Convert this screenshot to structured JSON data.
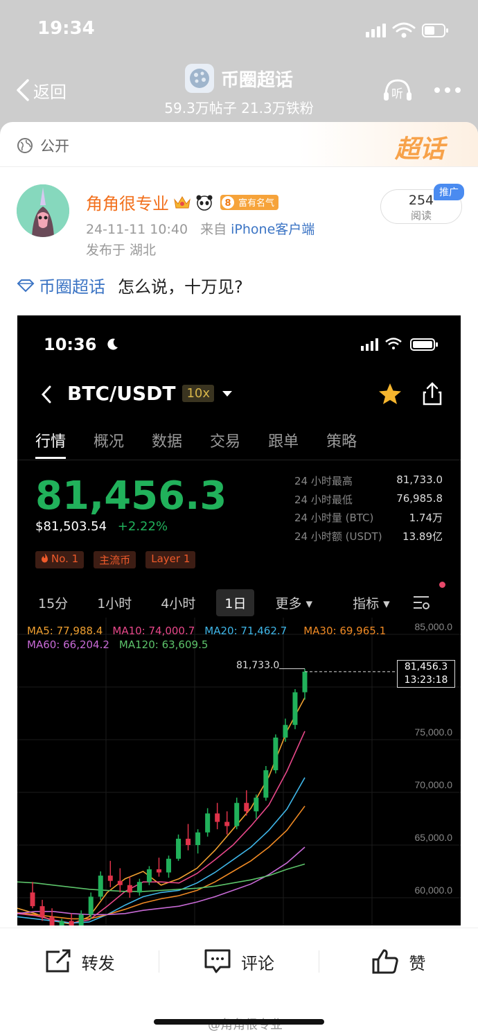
{
  "status_bar": {
    "time": "19:34"
  },
  "nav": {
    "back_label": "返回",
    "topic_name": "币圈超话",
    "topic_stats": "59.3万帖子 21.3万铁粉",
    "listen_label": "听"
  },
  "visibility": {
    "label": "公开",
    "badge": "超话"
  },
  "post": {
    "author": "角角很专业",
    "level_badge": "8",
    "level_text": "富有名气",
    "time": "24-11-11 10:40",
    "from_prefix": "来自",
    "source": "iPhone客户端",
    "location": "发布于 湖北",
    "reads": "254",
    "reads_label": "阅读",
    "promo_label": "推广",
    "topic_tag": "币圈超话",
    "text": "怎么说，十万见?"
  },
  "screenshot": {
    "status_time": "10:36",
    "pair": "BTC/USDT",
    "leverage": "10x",
    "tabs": [
      "行情",
      "概况",
      "数据",
      "交易",
      "跟单",
      "策略"
    ],
    "last_price": "81,456.3",
    "usd_price": "$81,503.54",
    "change_pct": "+2.22%",
    "stats": [
      {
        "label": "24 小时最高",
        "value": "81,733.0"
      },
      {
        "label": "24 小时最低",
        "value": "76,985.8"
      },
      {
        "label": "24 小时量 (BTC)",
        "value": "1.74万"
      },
      {
        "label": "24 小时额 (USDT)",
        "value": "13.89亿"
      }
    ],
    "chips": [
      "No. 1",
      "主流币",
      "Layer 1"
    ],
    "intervals": [
      "15分",
      "1小时",
      "4小时",
      "1日",
      "更多",
      "指标"
    ],
    "ma_row1": [
      {
        "label": "MA5: 77,988.4",
        "color": "#f0a030"
      },
      {
        "label": "MA10: 74,000.7",
        "color": "#e8488a"
      },
      {
        "label": "MA20: 71,462.7",
        "color": "#3fb6e8"
      },
      {
        "label": "MA30: 69,965.1",
        "color": "#f08a24"
      }
    ],
    "ma_row2": [
      {
        "label": "MA60: 66,204.2",
        "color": "#c86ad6"
      },
      {
        "label": "MA120: 63,609.5",
        "color": "#5cc36a"
      }
    ],
    "high_label": "81,733.0",
    "price_tag": "81,456.3",
    "price_tag_time": "13:23:18"
  },
  "chart_data": {
    "type": "line",
    "title": "",
    "y_ticks": [
      "85,000.0",
      "75,000.0",
      "70,000.0",
      "65,000.0",
      "60,000.0"
    ],
    "ylim": [
      58000,
      85000
    ],
    "series": [
      {
        "name": "MA5",
        "color": "#f0a030",
        "values": [
          59000,
          58500,
          57800,
          57500,
          58200,
          60500,
          61800,
          62500,
          61200,
          61800,
          62800,
          64500,
          66500,
          68500,
          71500,
          75800,
          79000
        ]
      },
      {
        "name": "MA10",
        "color": "#e8488a",
        "values": [
          58500,
          58300,
          57900,
          57600,
          57900,
          59200,
          60600,
          61500,
          61500,
          61400,
          62300,
          63600,
          65000,
          66800,
          68800,
          72000,
          75800
        ]
      },
      {
        "name": "MA20",
        "color": "#3fb6e8",
        "values": [
          58200,
          58000,
          57800,
          57600,
          57700,
          58400,
          59300,
          60100,
          60500,
          60700,
          61400,
          62400,
          63600,
          64800,
          66400,
          68400,
          71400
        ]
      },
      {
        "name": "MA30",
        "color": "#f08a24",
        "values": [
          58600,
          58400,
          58200,
          58000,
          58000,
          58400,
          58900,
          59500,
          59900,
          60200,
          60700,
          61500,
          62500,
          63500,
          64800,
          66400,
          68700
        ]
      },
      {
        "name": "MA60",
        "color": "#c86ad6",
        "values": [
          58500,
          58700,
          58700,
          58500,
          58400,
          58400,
          58500,
          58800,
          59000,
          59200,
          59600,
          60100,
          60700,
          61300,
          62200,
          63300,
          64800
        ]
      },
      {
        "name": "MA120",
        "color": "#5cc36a",
        "values": [
          61500,
          61400,
          61200,
          61000,
          60800,
          60700,
          60600,
          60600,
          60700,
          60800,
          60900,
          61100,
          61400,
          61700,
          62100,
          62700,
          63200
        ]
      }
    ],
    "candles": [
      [
        60500,
        61500,
        59000,
        59200
      ],
      [
        59200,
        59800,
        57800,
        58200
      ],
      [
        58200,
        59000,
        56800,
        57200
      ],
      [
        57200,
        58000,
        56500,
        57800
      ],
      [
        57800,
        58500,
        56600,
        57000
      ],
      [
        57000,
        58800,
        56800,
        58400
      ],
      [
        58400,
        60500,
        58000,
        60100
      ],
      [
        60100,
        62500,
        59800,
        62100
      ],
      [
        62100,
        63500,
        61000,
        61600
      ],
      [
        61600,
        62800,
        60500,
        61200
      ],
      [
        61200,
        62000,
        60000,
        60500
      ],
      [
        60500,
        61800,
        60200,
        61500
      ],
      [
        61500,
        63000,
        61200,
        62700
      ],
      [
        62700,
        63800,
        62000,
        62400
      ],
      [
        62400,
        64000,
        61900,
        63700
      ],
      [
        63700,
        66000,
        63500,
        65600
      ],
      [
        65600,
        67000,
        64500,
        65000
      ],
      [
        65000,
        66500,
        64200,
        66200
      ],
      [
        66200,
        68500,
        65800,
        68000
      ],
      [
        68000,
        69000,
        66500,
        67200
      ],
      [
        67200,
        68200,
        66000,
        66800
      ],
      [
        66800,
        69500,
        66500,
        69000
      ],
      [
        69000,
        70200,
        67800,
        68200
      ],
      [
        68200,
        69800,
        67500,
        69500
      ],
      [
        69500,
        72500,
        69200,
        72100
      ],
      [
        72100,
        75500,
        71800,
        75200
      ],
      [
        75200,
        77000,
        74800,
        76400
      ],
      [
        76400,
        79800,
        76000,
        79500
      ],
      [
        79500,
        81733,
        78800,
        81456
      ]
    ],
    "high": 81733.0,
    "last": 81456.3
  }
}
